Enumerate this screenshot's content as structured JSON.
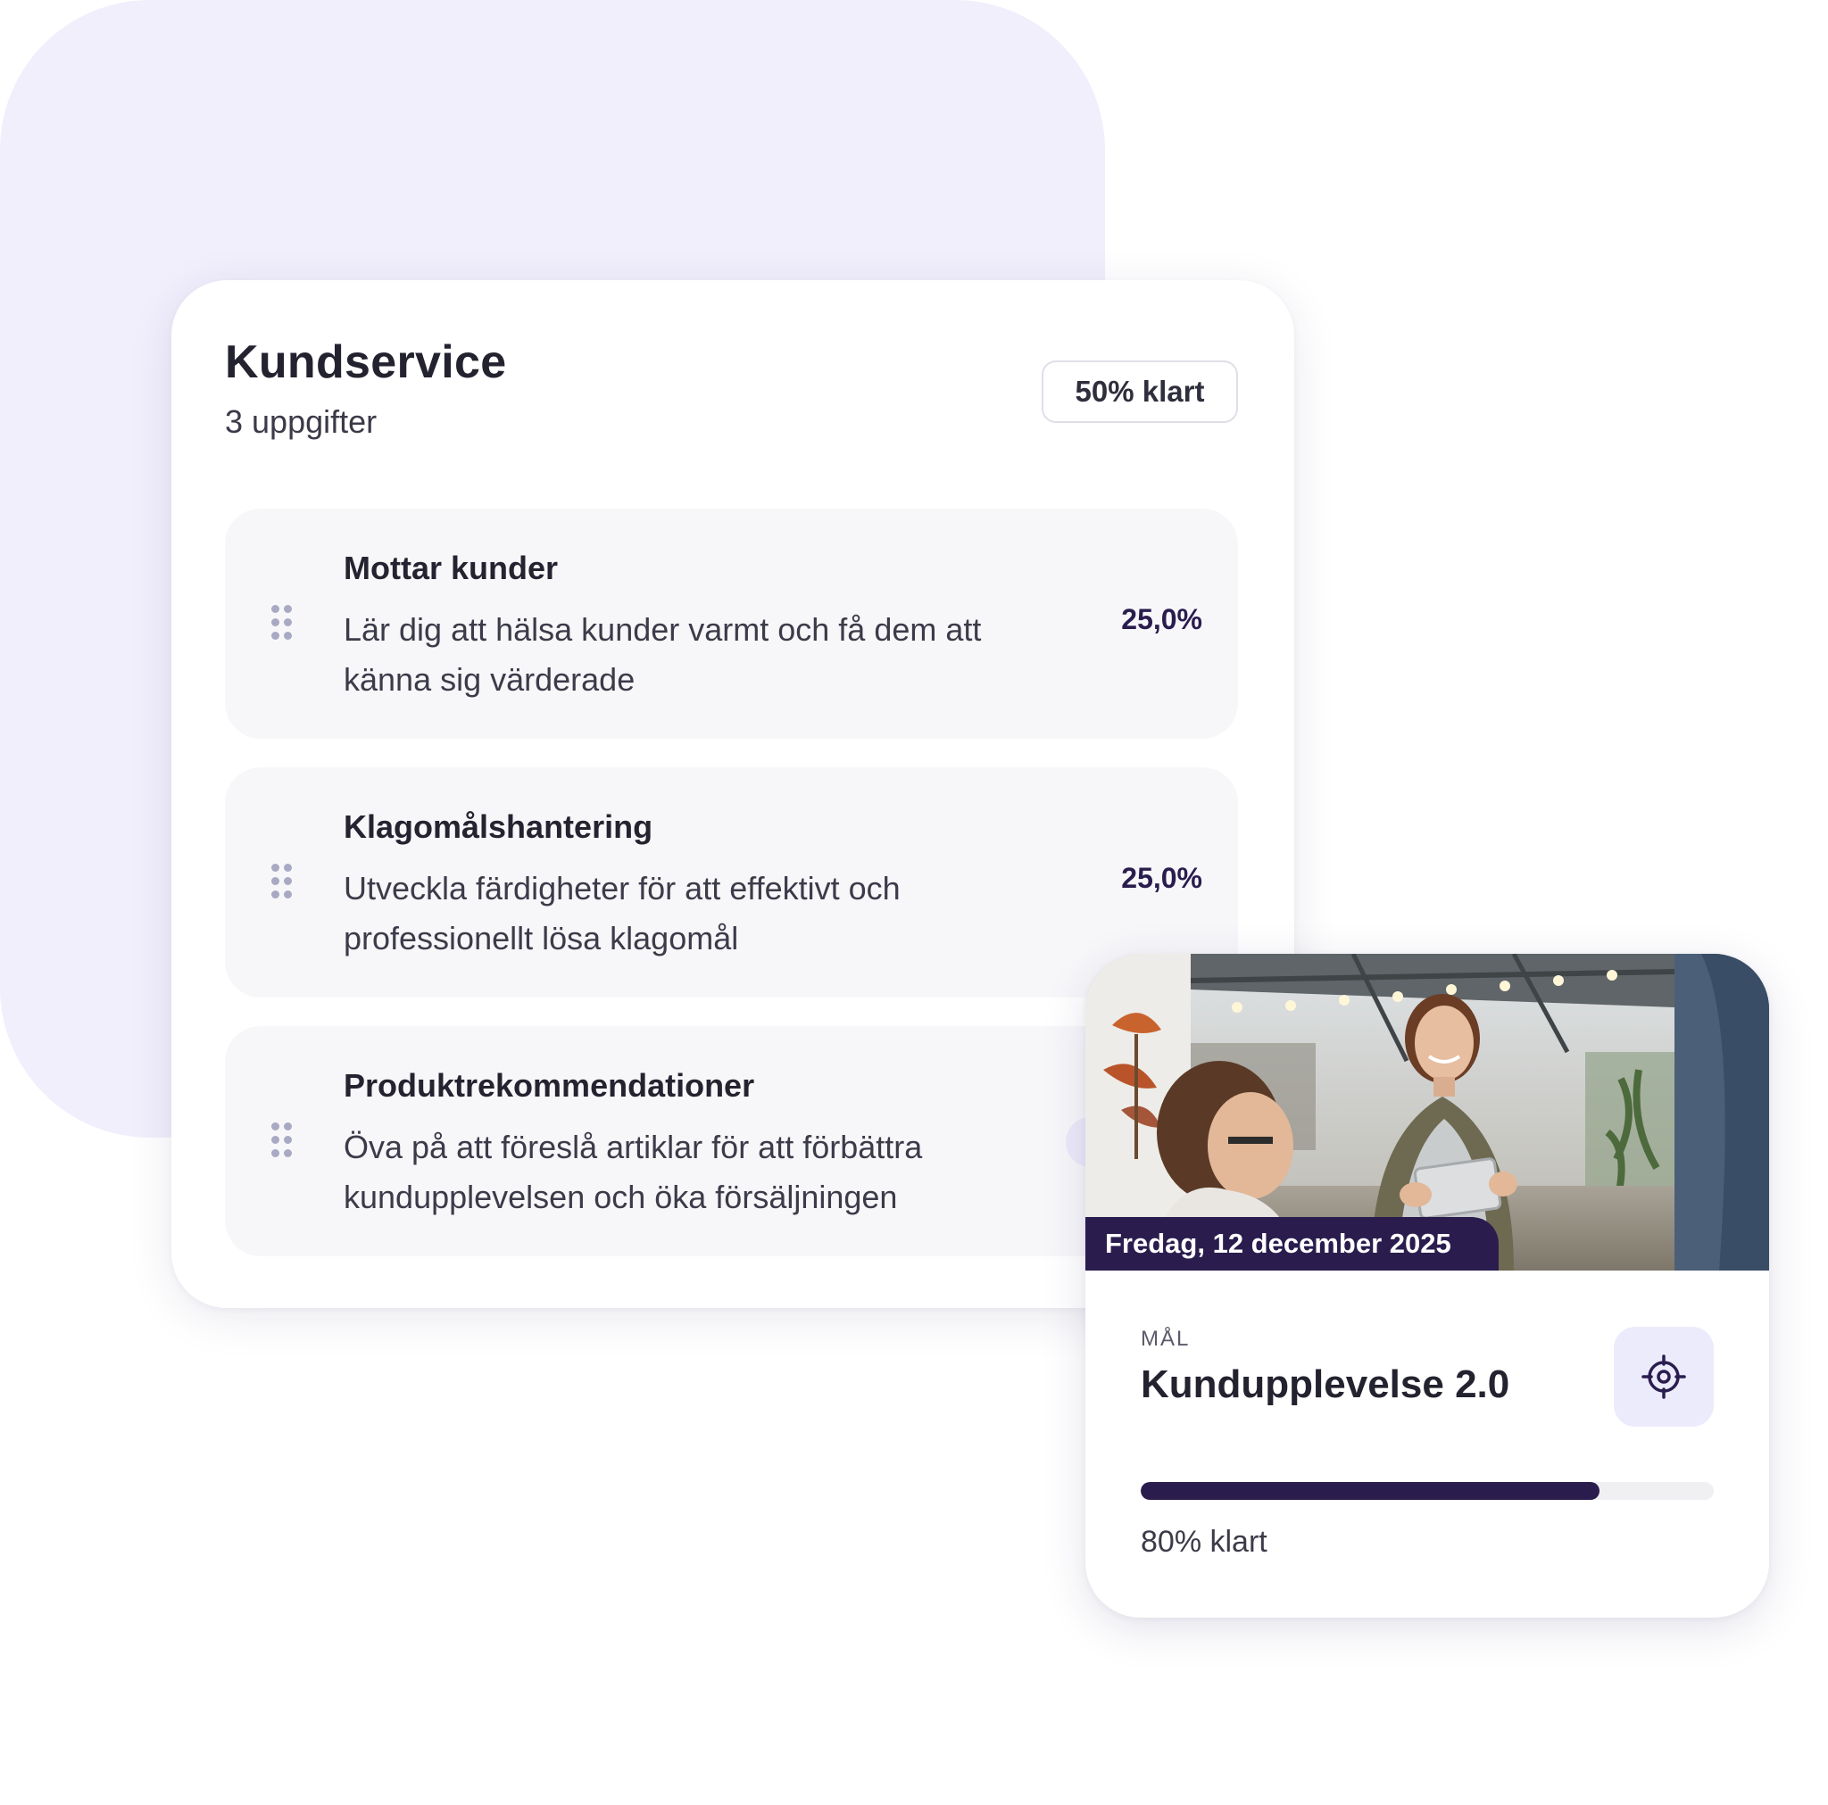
{
  "task_card": {
    "title": "Kundservice",
    "subtitle": "3 uppgifter",
    "badge": "50% klart",
    "items": [
      {
        "title": "Mottar kunder",
        "description": "Lär dig att hälsa kunder varmt och få dem att känna sig värderade",
        "percent": "25,0%"
      },
      {
        "title": "Klagomålshantering",
        "description": "Utveckla färdigheter för att effektivt och professionellt lösa klagomål",
        "percent": "25,0%"
      },
      {
        "title": "Produktrekommendationer",
        "description": "Öva på att föreslå artiklar för att förbättra kundupplevelsen och öka försäljningen",
        "percent": ""
      }
    ]
  },
  "goal_card": {
    "date": "Fredag, 12 december 2025",
    "eyebrow": "MÅL",
    "title": "Kundupplevelse 2.0",
    "progress_label": "80% klart",
    "progress_fraction": 0.8,
    "target_icon": "target-icon"
  },
  "colors": {
    "accent_dark": "#2a1d4e",
    "blob_bg": "#f1effc",
    "item_bg": "#f7f7fa",
    "icon_bg": "#ecebfb"
  }
}
